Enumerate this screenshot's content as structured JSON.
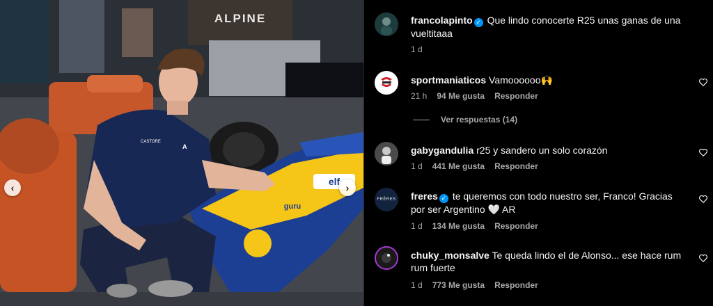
{
  "carousel": {
    "prev_icon": "chevron-left-icon",
    "next_icon": "chevron-right-icon",
    "prev_glyph": "‹",
    "next_glyph": "›"
  },
  "photo": {
    "signage_text": "ALPINE",
    "car_sponsors": [
      "elf",
      "guru"
    ],
    "shirt_logos": [
      "CASTORE",
      "A"
    ]
  },
  "comments": [
    {
      "username": "francolapinto",
      "verified": true,
      "text": "Que lindo conocerte R25 unas ganas de una vueltitaaa",
      "time": "1 d",
      "likes": "",
      "reply_label": "",
      "avatar_color": "#1e3b3c"
    },
    {
      "username": "sportmaniaticos",
      "verified": false,
      "text": "Vamoooooo🙌",
      "time": "21 h",
      "likes": "94 Me gusta",
      "reply_label": "Responder",
      "avatar_color": "#ffffff"
    },
    {
      "username": "gabygandulia",
      "verified": false,
      "text": "r25 y sandero un solo corazón",
      "time": "1 d",
      "likes": "441 Me gusta",
      "reply_label": "Responder",
      "avatar_color": "#5a5a5a"
    },
    {
      "username": "freres",
      "verified": true,
      "text": "te queremos con todo nuestro ser, Franco! Gracias por ser Argentino 🤍 AR",
      "time": "1 d",
      "likes": "134 Me gusta",
      "reply_label": "Responder",
      "avatar_color": "#12233e",
      "avatar_text": "FRÈRES"
    },
    {
      "username": "chuky_monsalve",
      "verified": false,
      "text": "Te queda lindo el de Alonso... ese hace rum rum fuerte",
      "time": "1 d",
      "likes": "773 Me gusta",
      "reply_label": "Responder",
      "avatar_color": "#111111"
    }
  ],
  "view_replies": "Ver respuestas (14)",
  "colors": {
    "background": "#000000",
    "text": "#f5f5f5",
    "muted": "#a8a8a8",
    "verified": "#0095f6",
    "car_yellow": "#f5c518",
    "car_blue": "#1c3f94"
  }
}
